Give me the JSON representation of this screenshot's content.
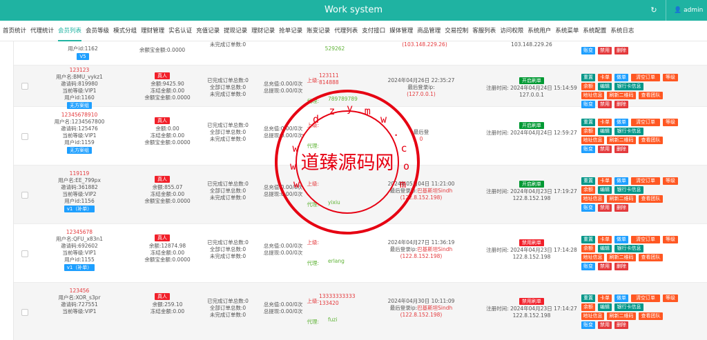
{
  "app_title": "Work system",
  "user": {
    "name": "admin"
  },
  "nav": [
    "首页统计",
    "代理统计",
    "会员列表",
    "会员等级",
    "模式分组",
    "理财管理",
    "实名认证",
    "充值记录",
    "提现记录",
    "理财记录",
    "抢单记录",
    "账变记录",
    "代理列表",
    "支付接口",
    "媒体管理",
    "商品管理",
    "交易控制",
    "客服列表",
    "访问权限",
    "系统用户",
    "系统菜单",
    "系统配置",
    "系统日志"
  ],
  "active_tab": "会员列表",
  "top_partial": {
    "uid": "用户id:1162",
    "level": "V5",
    "frozen": "余额宝金额:0.0000",
    "incomplete": "未完成订单数:0",
    "agent": "529262",
    "ip": "(103.148.229.26)",
    "ip2": "103.148.229.26",
    "b_change": "账变",
    "b_ban": "禁用",
    "b_del": "删除"
  },
  "rows": [
    {
      "name": "123123",
      "username": "用户名:BMU_vykz1",
      "invite": "邀请码:819980",
      "level": "当前等级:VIP1",
      "uid": "用户id:1160",
      "group": "无方案组",
      "tag": "真人",
      "balance": "余额:9425.90",
      "frozen": "冻结金额:0.00",
      "yeb": "余额宝金额:0.0000",
      "done": "已完成订单总数:0",
      "all": "全部订单总数:0",
      "undone": "未完成订单数:0",
      "recharge": "总充值:0.00/0次",
      "withdraw": "总提现:0.00/0次",
      "sup_label": "上级:",
      "sup": [
        "123111",
        "814888"
      ],
      "agent_label": "代理:",
      "agent": "789789789",
      "reg": "2024年04月26日 22:35:27",
      "last_login": "最后登录ip:",
      "login_place": "",
      "ip": "(127.0.0.1)",
      "state": "开启刷单",
      "reg_label": "注册时间:",
      "reg_time": "2024年04月24日 15:14:59",
      "reg_ip": "127.0.0.1"
    },
    {
      "name": "12345678910",
      "username": "用户名:1234567800",
      "invite": "邀请码:125476",
      "level": "当前等级:VIP1",
      "uid": "用户id:1159",
      "group": "无方案组",
      "tag": "真人",
      "balance": "余额:0.00",
      "frozen": "冻结金额:0.00",
      "yeb": "余额宝金额:0.0000",
      "done": "已完成订单总数:0",
      "all": "全部订单总数:0",
      "undone": "未完成订单数:0",
      "recharge": "总充值:0.00/0次",
      "withdraw": "总提现:0.00/0次",
      "sup_label": "上级:",
      "sup": [],
      "agent_label": "代理:",
      "agent": "",
      "reg": "",
      "last_login": "最后登",
      "login_place": "",
      "ip": "0",
      "state": "开启刷单",
      "reg_label": "注册时间:",
      "reg_time": "2024年04月24日 12:59:27",
      "reg_ip": ""
    },
    {
      "name": "119119",
      "username": "用户名:EE_799px",
      "invite": "邀请码:361882",
      "level": "当前等级:VIP2",
      "uid": "用户id:1156",
      "group": "v1（补单）",
      "tag": "真人",
      "balance": "余额:855.07",
      "frozen": "冻结金额:0.00",
      "yeb": "余额宝金额:0.0000",
      "done": "已完成订单总数:0",
      "all": "全部订单总数:0",
      "undone": "未完成订单数:0",
      "recharge": "总充值:0.00/0次",
      "withdraw": "总提现:0.00/0次",
      "sup_label": "上级:",
      "sup": [],
      "agent_label": "代理:",
      "agent": "yixiu",
      "reg": "2024年05月04日 11:21:00",
      "last_login": "最后登录ip:",
      "login_place": "巴基斯坦Sindh",
      "ip": "(122.8.152.198)",
      "state": "开启刷单",
      "reg_label": "注册时间:",
      "reg_time": "2024年04月23日 17:19:27",
      "reg_ip": "122.8.152.198"
    },
    {
      "name": "12345678",
      "username": "用户名:QFU_x83n1",
      "invite": "邀请码:692602",
      "level": "当前等级:VIP1",
      "uid": "用户id:1155",
      "group": "v1（补单）",
      "tag": "真人",
      "balance": "余额:12874.98",
      "frozen": "冻结金额:0.00",
      "yeb": "余额宝金额:0.0000",
      "done": "已完成订单总数:0",
      "all": "全部订单总数:0",
      "undone": "未完成订单数:0",
      "recharge": "总充值:0.00/0次",
      "withdraw": "总提现:0.00/0次",
      "sup_label": "上级:",
      "sup": [],
      "agent_label": "代理:",
      "agent": "erlang",
      "reg": "2024年04月27日 11:36:19",
      "last_login": "最后登录ip:",
      "login_place": "巴基斯坦Sindh",
      "ip": "(122.8.152.198)",
      "state": "禁用刷单",
      "reg_label": "注册时间:",
      "reg_time": "2024年04月23日 17:14:28",
      "reg_ip": "122.8.152.198"
    },
    {
      "name": "123456",
      "username": "用户名:XOR_s3pr",
      "invite": "邀请码:727551",
      "level": "当前等级:VIP1",
      "uid": "",
      "group": "",
      "tag": "真人",
      "balance": "余额:259.10",
      "frozen": "冻结金额:0.00",
      "yeb": "",
      "done": "已完成订单总数:0",
      "all": "全部订单总数:0",
      "undone": "未完成订单数:0",
      "recharge": "总充值:0.00/0次",
      "withdraw": "总提现:0.00/0次",
      "sup_label": "上级:",
      "sup": [
        "13333333333",
        "133420"
      ],
      "agent_label": "代理:",
      "agent": "fuzi",
      "reg": "2024年04月30日 10:11:09",
      "last_login": "最后登录ip:",
      "login_place": "巴基斯坦Sindh",
      "ip": "(122.8.152.198)",
      "state": "禁用刷单",
      "reg_label": "注册时间:",
      "reg_time": "2024年04月23日 17:14:27",
      "reg_ip": "122.8.152.198"
    }
  ],
  "actions": [
    "重置",
    "卡单",
    "做单",
    "清空订单",
    "等级",
    "余额",
    "编辑",
    "银行卡信息",
    "地址信息",
    "刷新二维码",
    "查看团队",
    "账变",
    "禁用",
    "删除"
  ],
  "watermark": {
    "text": "道臻源码网",
    "url": "www.dzymw.com"
  },
  "colors": {
    "header": "#1fb3a2",
    "red": "#e4393c",
    "green": "#009933",
    "blue": "#1e9fff",
    "orange": "#ff5722",
    "teal": "#009688"
  }
}
